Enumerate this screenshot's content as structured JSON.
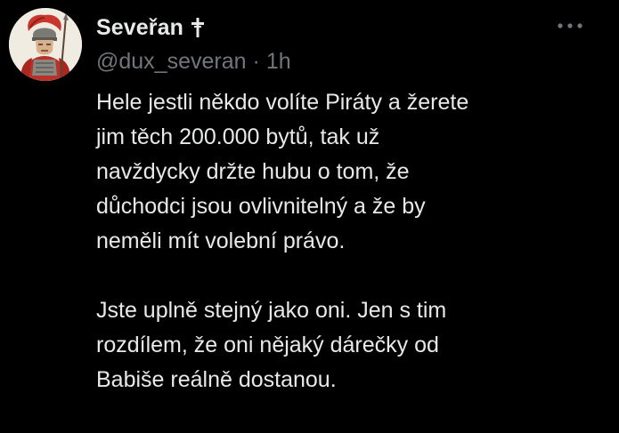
{
  "author": {
    "display_name": "Severan",
    "display_name_full": "Severan",
    "badge_icon": "cross-icon",
    "handle": "@dux_severan",
    "separator": "·",
    "time": "1h"
  },
  "more_icon": "more-options-icon",
  "tweet": {
    "lines": [
      "Hele jestli někdo volíte Piráty a žerete",
      "jim těch 200.000 bytů, tak už",
      "navždycky držte hubu o tom, že",
      "důchodci jsou ovlivnitelný a že by",
      "neměli mít volební právo.",
      "",
      "Jste uplně stejný jako oni. Jen s tim",
      "rozdílem, že oni nějaký dárečky od",
      "Babiše reálně dostanou."
    ]
  },
  "colors": {
    "background": "#000000",
    "text": "#e7e9ea",
    "secondary_text": "#71767b"
  }
}
